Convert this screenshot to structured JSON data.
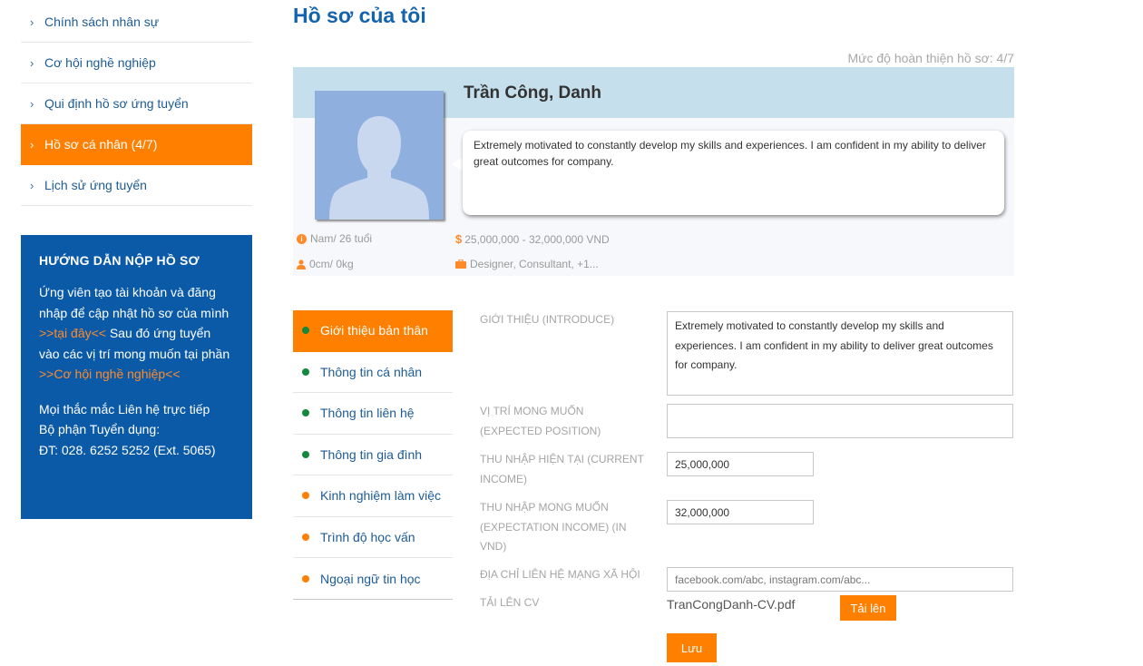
{
  "left_nav": {
    "items": [
      {
        "label": "Chính sách nhân sự"
      },
      {
        "label": "Cơ hội nghề nghiệp"
      },
      {
        "label": "Qui định hồ sơ ứng tuyển"
      },
      {
        "label": "Hồ sơ cá nhân (4/7)",
        "active": true
      },
      {
        "label": "Lịch sử ứng tuyển"
      }
    ]
  },
  "guide": {
    "title": "HƯỚNG DẪN NỘP HỒ SƠ",
    "p1_before": "Ứng viên tạo tài khoản và đăng nhập để cập nhật hồ sơ của mình ",
    "p1_link": ">>tại đây<<",
    "p1_after": "  Sau đó ứng tuyển vào các vị trí mong muốn tại phần",
    "p1_link2": ">>Cơ hội nghề nghiệp<<",
    "p2_line1": "Mọi thắc mắc Liên hệ trực tiếp",
    "p2_line2": "Bộ phận Tuyển dụng:",
    "p2_line3": "ĐT: 028. 6252 5252 (Ext. 5065)"
  },
  "page": {
    "title": "Hồ sơ của tôi",
    "completion": "Mức độ hoàn thiện hồ sơ: 4/7"
  },
  "profile": {
    "name": "Trần Công, Danh",
    "bio": "Extremely motivated to constantly develop my skills and experiences. I am confident in my ability to deliver great outcomes for company.",
    "gender_age": "Nam/ 26 tuổi",
    "salary_range": "25,000,000 - 32,000,000 VND",
    "height_weight": "0cm/ 0kg",
    "positions": "Designer, Consultant, +1..."
  },
  "tabs": [
    {
      "label": "Giới thiệu bản thân",
      "status": "green",
      "active": true
    },
    {
      "label": "Thông tin cá nhân",
      "status": "green"
    },
    {
      "label": "Thông tin liên hệ",
      "status": "green"
    },
    {
      "label": "Thông tin gia đình",
      "status": "green"
    },
    {
      "label": "Kinh nghiệm làm việc",
      "status": "orange"
    },
    {
      "label": "Trình độ học vấn",
      "status": "orange"
    },
    {
      "label": "Ngoại ngữ tin học",
      "status": "orange"
    }
  ],
  "form": {
    "intro_label": "GIỚI THIỆU (INTRODUCE)",
    "intro_value": "Extremely motivated to constantly develop my skills and experiences. I am confident in my ability to deliver great outcomes for company.",
    "position_label": "VỊ TRÍ MONG MUỐN (EXPECTED POSITION)",
    "position_value": "",
    "current_income_label": "THU NHẬP HIỆN TẠI (CURRENT INCOME)",
    "current_income_value": "25,000,000",
    "expected_income_label": "THU NHẬP MONG MUỐN (EXPECTATION INCOME) (IN VND)",
    "expected_income_value": "32,000,000",
    "social_label": "ĐỊA CHỈ LIÊN HỆ MẠNG XÃ HỘI",
    "social_placeholder": "facebook.com/abc, instagram.com/abc...",
    "cv_label": "TẢI LÊN CV",
    "cv_filename": "TranCongDanh-CV.pdf",
    "upload_label": "Tải lên",
    "save_label": "Lưu"
  },
  "colors": {
    "accent": "#ff7f00",
    "primary": "#0b5aa8",
    "title": "#1463ad",
    "status_done": "#14893c",
    "status_todo": "#ff7f00"
  }
}
